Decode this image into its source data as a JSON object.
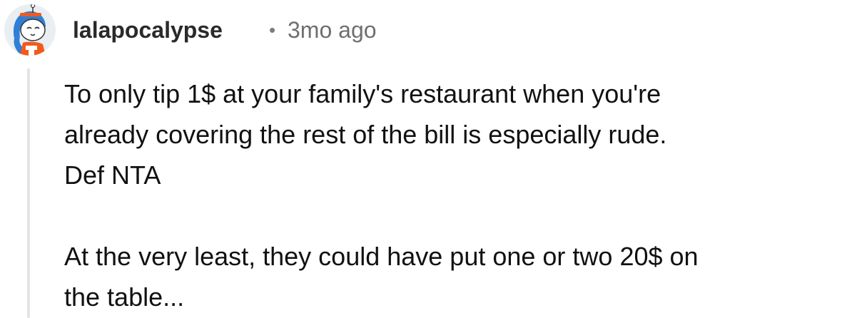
{
  "comment": {
    "author": "lalapocalypse",
    "separator": "•",
    "timestamp": "3mo ago",
    "avatar_icon": "snoo-avatar-icon",
    "paragraphs": [
      "To only tip 1$ at your family's restaurant when you're\nalready covering the rest of the bill is especially rude.\nDef NTA",
      "At the very least, they could have put one or two 20$ on\nthe table..."
    ]
  },
  "colors": {
    "username": "#2a2a2a",
    "timestamp": "#6f6f6f",
    "body_text": "#111111",
    "thread_line": "#e4e4e4",
    "avatar_hair": "#2f7fd6",
    "avatar_outfit": "#f25a1c"
  }
}
